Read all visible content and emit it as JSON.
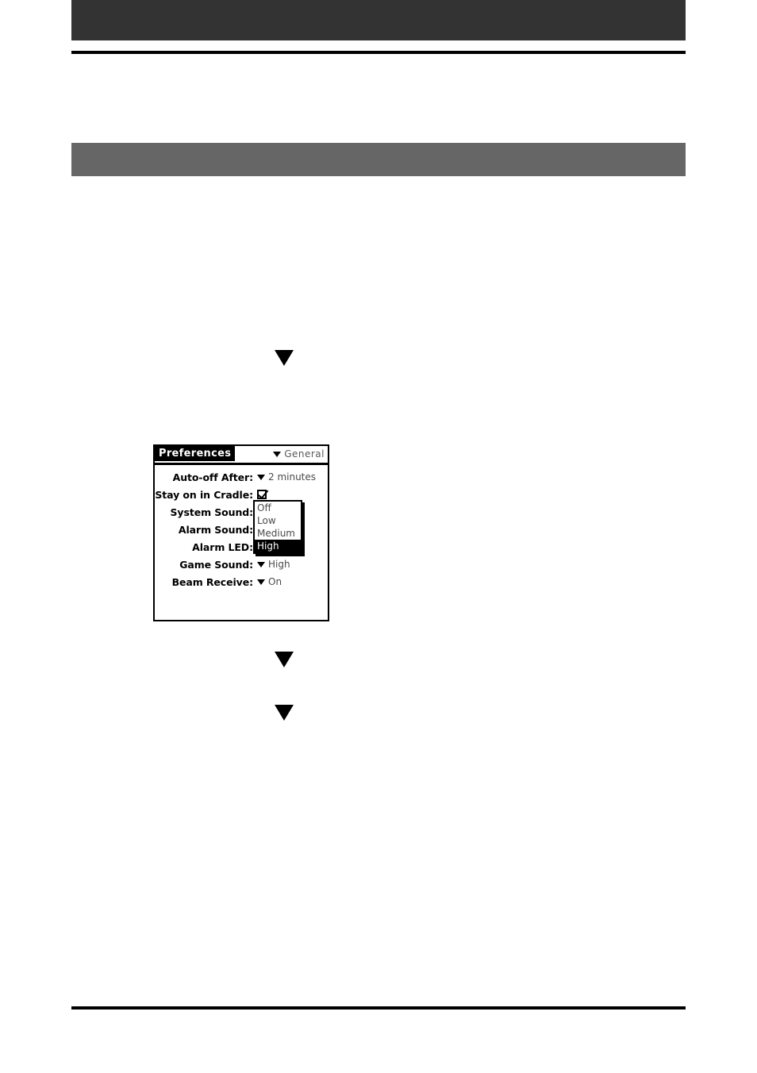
{
  "page": {
    "background": "#ffffff",
    "header_band_color": "#333333",
    "section_band_color": "#666666",
    "rule_color": "#000000"
  },
  "markers": [
    {
      "name": "step-marker-1",
      "glyph": "down-triangle"
    },
    {
      "name": "step-marker-2",
      "glyph": "down-triangle"
    },
    {
      "name": "step-marker-3",
      "glyph": "down-triangle"
    }
  ],
  "device_screen": {
    "title": "Preferences",
    "category": "General",
    "category_icon": "chevron-down-icon",
    "rows": [
      {
        "label": "Auto-off After:",
        "value": "2 minutes",
        "control": "picker"
      },
      {
        "label": "Stay on in Cradle:",
        "value": "",
        "control": "checkbox",
        "checked": true
      },
      {
        "label": "System Sound:",
        "value": "",
        "control": "picker-open"
      },
      {
        "label": "Alarm Sound:",
        "value": "",
        "control": "picker-open"
      },
      {
        "label": "Alarm LED:",
        "value": "",
        "control": "picker-open"
      },
      {
        "label": "Game Sound:",
        "value": "High",
        "control": "picker"
      },
      {
        "label": "Beam Receive:",
        "value": "On",
        "control": "picker"
      }
    ],
    "popup": {
      "name": "sound-level-popup",
      "options": [
        "Off",
        "Low",
        "Medium",
        "High"
      ],
      "selected": "High"
    }
  }
}
